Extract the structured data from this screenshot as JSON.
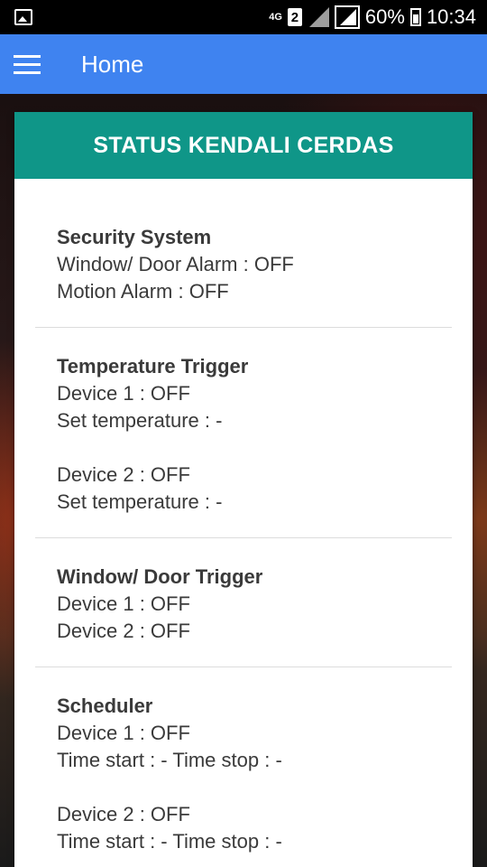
{
  "status_bar": {
    "network": "4G",
    "sim": "2",
    "battery": "60%",
    "time": "10:34"
  },
  "app_bar": {
    "title": "Home"
  },
  "card": {
    "header": "STATUS KENDALI CERDAS",
    "sections": [
      {
        "title": "Security System",
        "lines": [
          "Window/ Door Alarm : OFF",
          "Motion Alarm : OFF"
        ]
      },
      {
        "title": "Temperature Trigger",
        "lines": [
          "Device 1 : OFF",
          "Set temperature : -",
          "",
          "Device 2 : OFF",
          "Set temperature : -"
        ]
      },
      {
        "title": "Window/ Door Trigger",
        "lines": [
          "Device 1 : OFF",
          "Device 2 : OFF"
        ]
      },
      {
        "title": "Scheduler",
        "lines": [
          "Device 1 : OFF",
          "Time start : - Time stop : -",
          "",
          "Device 2 : OFF",
          "Time start : - Time stop : -"
        ]
      }
    ]
  },
  "colors": {
    "app_bar": "#3f83f0",
    "card_header": "#0f9688"
  },
  "icons": {
    "status_left": "gallery-icon",
    "menu": "hamburger-menu-icon"
  }
}
